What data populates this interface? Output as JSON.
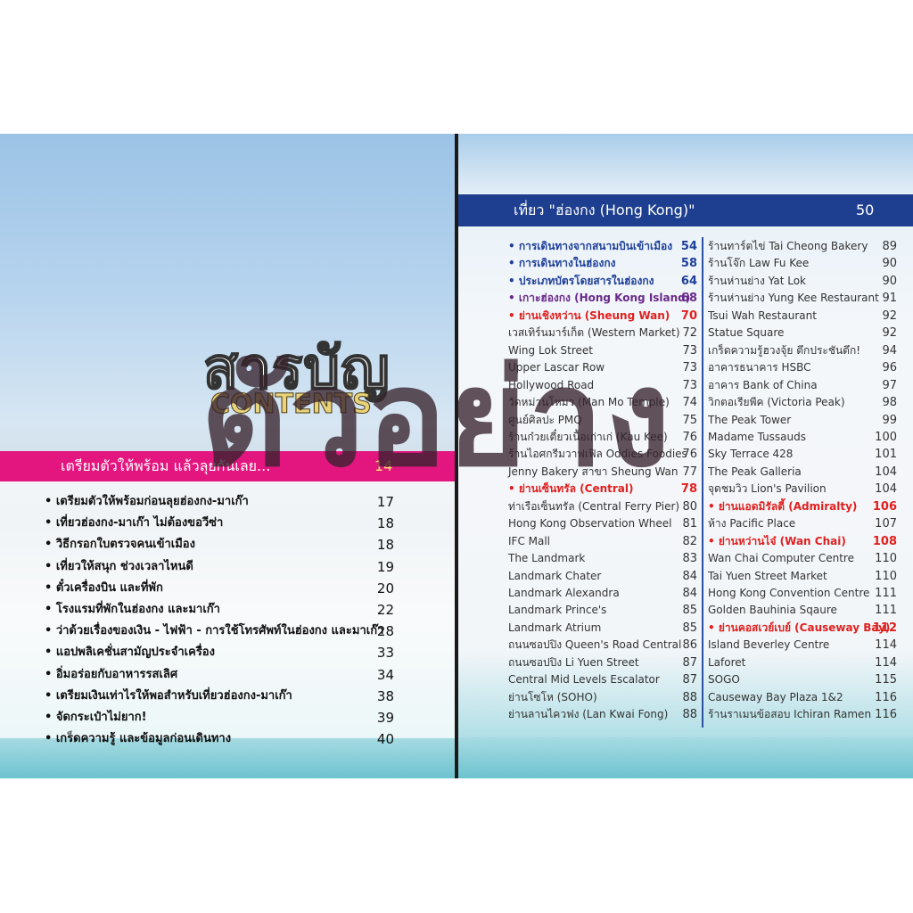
{
  "left_page": {
    "title_th": "สารบัญ",
    "title_en": "CONTENTS",
    "section": {
      "title": "เตรียมตัวให้พร้อม แล้วลุยกันเลย...",
      "page": "14"
    },
    "items": [
      {
        "label": "• เตรียมตัวให้พร้อมก่อนลุยฮ่องกง-มาเก๊า",
        "page": "17"
      },
      {
        "label": "• เที่ยวฮ่องกง-มาเก๊า ไม่ต้องขอวีซ่า",
        "page": "18"
      },
      {
        "label": "• วิธีกรอกใบตรวจคนเข้าเมือง",
        "page": "18"
      },
      {
        "label": "• เที่ยวให้สนุก ช่วงเวลาไหนดี",
        "page": "19"
      },
      {
        "label": "• ตั๋วเครื่องบิน และที่พัก",
        "page": "20"
      },
      {
        "label": "• โรงแรมที่พักในฮ่องกง และมาเก๊า",
        "page": "22"
      },
      {
        "label": "• ว่าด้วยเรื่องของเงิน - ไฟฟ้า - การใช้โทรศัพท์ในฮ่องกง และมาเก๊า",
        "page": "28"
      },
      {
        "label": "• แอปพลิเคชั่นสามัญประจำเครื่อง",
        "page": "33"
      },
      {
        "label": "• อิ่มอร่อยกับอาหารรสเลิศ",
        "page": "34"
      },
      {
        "label": "• เตรียมเงินเท่าไรให้พอสำหรับเที่ยวฮ่องกง-มาเก๊า",
        "page": "38"
      },
      {
        "label": "• จัดกระเป๋าไม่ยาก!",
        "page": "39"
      },
      {
        "label": "• เกร็ดความรู้ และข้อมูลก่อนเดินทาง",
        "page": "40"
      }
    ]
  },
  "right_page": {
    "section": {
      "title": "เที่ยว \"ฮ่องกง (Hong Kong)\"",
      "page": "50"
    },
    "col1": [
      {
        "label": "• การเดินทางจากสนามบินเข้าเมือง",
        "page": "54",
        "style": "blue"
      },
      {
        "label": "• การเดินทางในฮ่องกง",
        "page": "58",
        "style": "blue"
      },
      {
        "label": "• ประเภทบัตรโดยสารในฮ่องกง",
        "page": "64",
        "style": "blue"
      },
      {
        "label": "• เกาะฮ่องกง (Hong Kong Island)",
        "page": "68",
        "style": "purple"
      },
      {
        "label": "• ย่านเชิงหว่าน (Sheung Wan)",
        "page": "70",
        "style": "red"
      },
      {
        "label": "เวสเทิร์นมาร์เก็ต (Western Market)",
        "page": "72",
        "style": ""
      },
      {
        "label": "Wing Lok Street",
        "page": "73",
        "style": ""
      },
      {
        "label": "Upper Lascar Row",
        "page": "73",
        "style": ""
      },
      {
        "label": "Hollywood Road",
        "page": "73",
        "style": ""
      },
      {
        "label": "วัดหม่านโหมว (Man Mo Temple)",
        "page": "74",
        "style": ""
      },
      {
        "label": "ศูนย์ศิลปะ PMQ",
        "page": "75",
        "style": ""
      },
      {
        "label": "ร้านก๋วยเตี๋ยวเนื้อเก่าเก่ (Kau Kee)",
        "page": "76",
        "style": ""
      },
      {
        "label": "ร้านไอศกรีมวาฟเฟิล Oddies Foodies",
        "page": "76",
        "style": ""
      },
      {
        "label": "Jenny Bakery สาขา Sheung Wan",
        "page": "77",
        "style": ""
      },
      {
        "label": "• ย่านเซ็นทรัล (Central)",
        "page": "78",
        "style": "red"
      },
      {
        "label": "ท่าเรือเซ็นทรัล (Central Ferry Pier)",
        "page": "80",
        "style": ""
      },
      {
        "label": "Hong Kong Observation Wheel",
        "page": "81",
        "style": ""
      },
      {
        "label": "IFC Mall",
        "page": "82",
        "style": ""
      },
      {
        "label": "The Landmark",
        "page": "83",
        "style": ""
      },
      {
        "label": "Landmark Chater",
        "page": "84",
        "style": ""
      },
      {
        "label": "Landmark Alexandra",
        "page": "84",
        "style": ""
      },
      {
        "label": "Landmark Prince's",
        "page": "85",
        "style": ""
      },
      {
        "label": "Landmark Atrium",
        "page": "85",
        "style": ""
      },
      {
        "label": "ถนนซอปปิง Queen's Road Central",
        "page": "86",
        "style": ""
      },
      {
        "label": "ถนนซอปปิง Li Yuen Street",
        "page": "87",
        "style": ""
      },
      {
        "label": "Central Mid Levels Escalator",
        "page": "87",
        "style": ""
      },
      {
        "label": "ย่านโซโห (SOHO)",
        "page": "88",
        "style": ""
      },
      {
        "label": "ย่านลานไควฟง (Lan Kwai Fong)",
        "page": "88",
        "style": ""
      }
    ],
    "col2": [
      {
        "label": "ร้านทาร์ตไข่ Tai Cheong Bakery",
        "page": "89",
        "style": ""
      },
      {
        "label": "ร้านโจ๊ก Law Fu Kee",
        "page": "90",
        "style": ""
      },
      {
        "label": "ร้านห่านย่าง Yat Lok",
        "page": "90",
        "style": ""
      },
      {
        "label": "ร้านห่านย่าง Yung Kee Restaurant",
        "page": "91",
        "style": ""
      },
      {
        "label": "Tsui Wah Restaurant",
        "page": "92",
        "style": ""
      },
      {
        "label": "Statue Square",
        "page": "92",
        "style": ""
      },
      {
        "label": "เกร็ดความรู้ฮวงจุ้ย ตึกประชันตึก!",
        "page": "94",
        "style": ""
      },
      {
        "label": "อาคารธนาคาร HSBC",
        "page": "96",
        "style": ""
      },
      {
        "label": "อาคาร Bank of China",
        "page": "97",
        "style": ""
      },
      {
        "label": "วิกตอเรียพีค (Victoria Peak)",
        "page": "98",
        "style": ""
      },
      {
        "label": "The Peak Tower",
        "page": "99",
        "style": ""
      },
      {
        "label": "Madame Tussauds",
        "page": "100",
        "style": ""
      },
      {
        "label": "Sky Terrace 428",
        "page": "101",
        "style": ""
      },
      {
        "label": "The Peak Galleria",
        "page": "104",
        "style": ""
      },
      {
        "label": "จุดชมวิว Lion's Pavilion",
        "page": "104",
        "style": ""
      },
      {
        "label": "• ย่านแอดมิรัลตี้ (Admiralty)",
        "page": "106",
        "style": "red"
      },
      {
        "label": "ห้าง Pacific Place",
        "page": "107",
        "style": ""
      },
      {
        "label": "• ย่านหว่านไจ๋ (Wan Chai)",
        "page": "108",
        "style": "red"
      },
      {
        "label": "Wan Chai Computer Centre",
        "page": "110",
        "style": ""
      },
      {
        "label": "Tai Yuen Street Market",
        "page": "110",
        "style": ""
      },
      {
        "label": "Hong Kong Convention Centre",
        "page": "111",
        "style": ""
      },
      {
        "label": "Golden Bauhinia Sqaure",
        "page": "111",
        "style": ""
      },
      {
        "label": "• ย่านคอสเวย์เบย์ (Causeway Bay)",
        "page": "112",
        "style": "red"
      },
      {
        "label": "Island Beverley Centre",
        "page": "114",
        "style": ""
      },
      {
        "label": "Laforet",
        "page": "114",
        "style": ""
      },
      {
        "label": "SOGO",
        "page": "115",
        "style": ""
      },
      {
        "label": "Causeway Bay Plaza 1&2",
        "page": "116",
        "style": ""
      },
      {
        "label": "ร้านราเมนข้อสอบ Ichiran Ramen",
        "page": "116",
        "style": ""
      }
    ]
  },
  "watermark": "ตัวอย่าง",
  "colors": {
    "pink_bar": "#e3157f",
    "blue_bar": "#1e3f8f",
    "red_heading": "#e0201f",
    "blue_heading": "#1e3f9a",
    "purple_heading": "#6a2a8a"
  }
}
